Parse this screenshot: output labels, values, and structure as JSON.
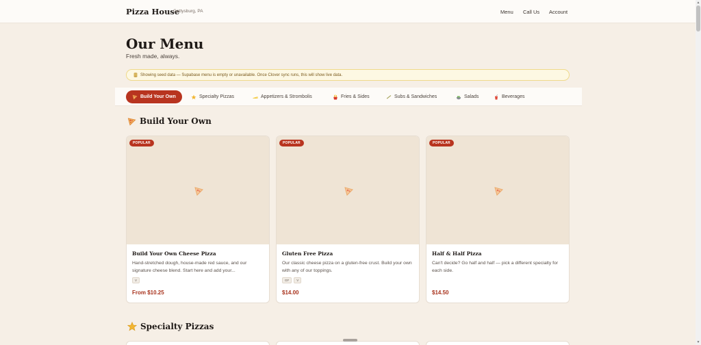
{
  "header": {
    "brand": "Pizza House",
    "location": "Gettysburg, PA",
    "nav": {
      "menu": "Menu",
      "call": "Call Us",
      "account": "Account"
    }
  },
  "page": {
    "title": "Our Menu",
    "subtitle": "Fresh made, always.",
    "notice": "Showing seed data — Supabase menu is empty or unavailable. Once Clover sync runs, this will show live data."
  },
  "categories": [
    {
      "label": "Build Your Own",
      "icon": "pizza-icon",
      "active": true
    },
    {
      "label": "Specialty Pizzas",
      "icon": "star-icon"
    },
    {
      "label": "Appetizers & Strombolis",
      "icon": "cheese-icon"
    },
    {
      "label": "Fries & Sides",
      "icon": "fries-icon"
    },
    {
      "label": "Subs & Sandwiches",
      "icon": "sandwich-icon"
    },
    {
      "label": "Salads",
      "icon": "salad-icon"
    },
    {
      "label": "Beverages",
      "icon": "drink-icon"
    }
  ],
  "sections": [
    {
      "title": "Build Your Own",
      "icon": "pizza-icon"
    },
    {
      "title": "Specialty Pizzas",
      "icon": "star-icon"
    }
  ],
  "cards": [
    {
      "badge": "POPULAR",
      "title": "Build Your Own Cheese Pizza",
      "description": "Hand-stretched dough, house-made red sauce, and our signature cheese blend. Start here and add your...",
      "tags": [
        "V"
      ],
      "price": "From $10.25"
    },
    {
      "badge": "POPULAR",
      "title": "Gluten Free Pizza",
      "description": "Our classic cheese pizza on a gluten-free crust. Build your own with any of our toppings.",
      "tags": [
        "GF",
        "V"
      ],
      "price": "$14.00"
    },
    {
      "badge": "POPULAR",
      "title": "Half & Half Pizza",
      "description": "Can't decide? Go half and half — pick a different specialty for each side.",
      "tags": [],
      "price": "$14.50"
    }
  ],
  "colors": {
    "accent": "#b8341f",
    "background": "#f6efe6",
    "card_image": "#efe4d5"
  }
}
